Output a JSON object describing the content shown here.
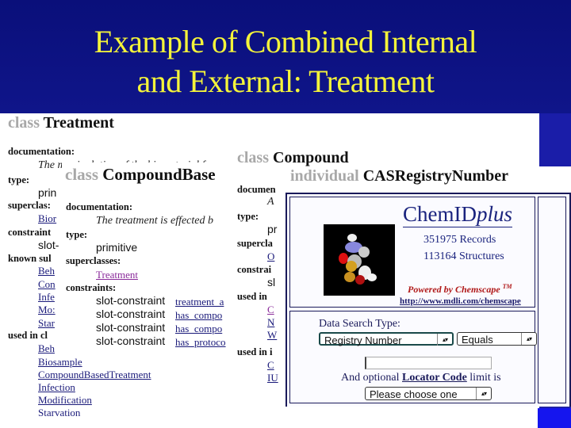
{
  "slide": {
    "title_line1": "Example of Combined Internal",
    "title_line2": "and External: Treatment"
  },
  "treatment_panel": {
    "keyword": "class",
    "name": "Treatment",
    "documentation_label": "documentation:",
    "documentation_text": "The manipulation of the biomaterial for",
    "type_label": "type:",
    "type_value": "prin",
    "superclasses_label": "superclas:",
    "superclasses": [
      "Bior"
    ],
    "constraints_label": "constraint",
    "constraints": [
      "slot-"
    ],
    "known_subclasses_label": "known sul",
    "known_subclasses": [
      "Beh",
      "Con",
      "Infe",
      "Mo:",
      "Star"
    ],
    "used_in_label": "used in cl",
    "used_in": [
      "Beh",
      "Biosample",
      "CompoundBasedTreatment",
      "Infection",
      "Modification",
      "Starvation"
    ]
  },
  "compound_base_panel": {
    "keyword": "class",
    "name": "CompoundBase",
    "documentation_label": "documentation:",
    "documentation_text": "The treatment is effected b",
    "type_label": "type:",
    "type_value": "primitive",
    "superclasses_label": "superclasses:",
    "superclasses": [
      "Treatment"
    ],
    "constraints_label": "constraints:",
    "constraints": [
      {
        "kind": "slot-constraint",
        "slot": "treatment_a"
      },
      {
        "kind": "slot-constraint",
        "slot": "has_compo"
      },
      {
        "kind": "slot-constraint",
        "slot": "has_compo"
      },
      {
        "kind": "slot-constraint",
        "slot": "has_protoco"
      }
    ]
  },
  "compound_panel": {
    "keyword": "class",
    "name": "Compound",
    "documentation_label": "documen",
    "documentation_text": "A",
    "type_label": "type:",
    "type_value": "pr",
    "superclasses_label": "supercla",
    "superclasses": [
      "O"
    ],
    "constraints_label": "constrai",
    "constraints": [
      "sl"
    ],
    "used_in_label_1": "used in",
    "used_in_1": [
      "C",
      "N",
      "W"
    ],
    "used_in_label_2": "used in i",
    "used_in_2": [
      "C",
      "IU"
    ]
  },
  "cas_panel": {
    "keyword": "individual",
    "name": "CASRegistryNumber",
    "chemid": {
      "title_main": "ChemID",
      "title_italic": "plus",
      "records": "351975 Records",
      "structures": "113164 Structures",
      "powered_by": "Powered by Chemscape",
      "tm": "TM",
      "url": "http://www.mdli.com/chemscape"
    },
    "search": {
      "label": "Data Search Type:",
      "type_select": "Registry Number",
      "operator_select": "Equals",
      "query_value": "",
      "optional_prefix": "And optional",
      "optional_link": "Locator Code",
      "optional_suffix": "limit is",
      "locator_select": "Please choose one"
    }
  },
  "icons": {
    "select_arrows": "↕"
  },
  "colors": {
    "slide_bg": "#10168c",
    "title_yellow": "#f4f43a",
    "link_blue": "#1a1a7a",
    "chemid_blue": "#1a237e",
    "powered_red": "#b01818"
  }
}
